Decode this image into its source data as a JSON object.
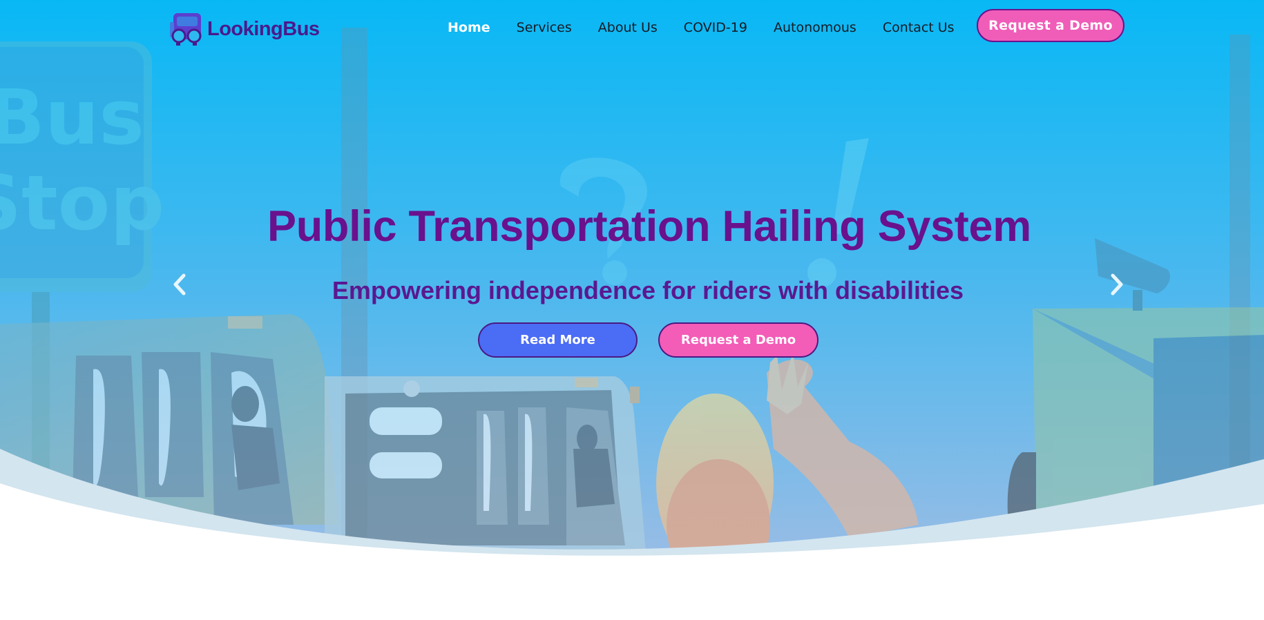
{
  "brand": {
    "name": "LookingBus"
  },
  "nav": {
    "items": [
      {
        "label": "Home",
        "active": true
      },
      {
        "label": "Services",
        "active": false
      },
      {
        "label": "About Us",
        "active": false
      },
      {
        "label": "COVID-19",
        "active": false
      },
      {
        "label": "Autonomous",
        "active": false
      },
      {
        "label": "Contact Us",
        "active": false
      }
    ],
    "cta_label": "Request a Demo"
  },
  "hero": {
    "title": "Public Transportation Hailing System",
    "subtitle": "Empowering independence for riders with disabilities",
    "primary_button": "Read More",
    "secondary_button": "Request a Demo",
    "sign_text_line1": "Bus",
    "sign_text_line2": "Stop",
    "prev_icon": "chevron-left-icon",
    "next_icon": "chevron-right-icon"
  },
  "colors": {
    "sky_top": "#08b8f5",
    "sky_bottom": "#a0bde6",
    "title_purple": "#6a118d",
    "cta_pink": "#f05db8",
    "read_more_blue": "#4b6cf5"
  }
}
